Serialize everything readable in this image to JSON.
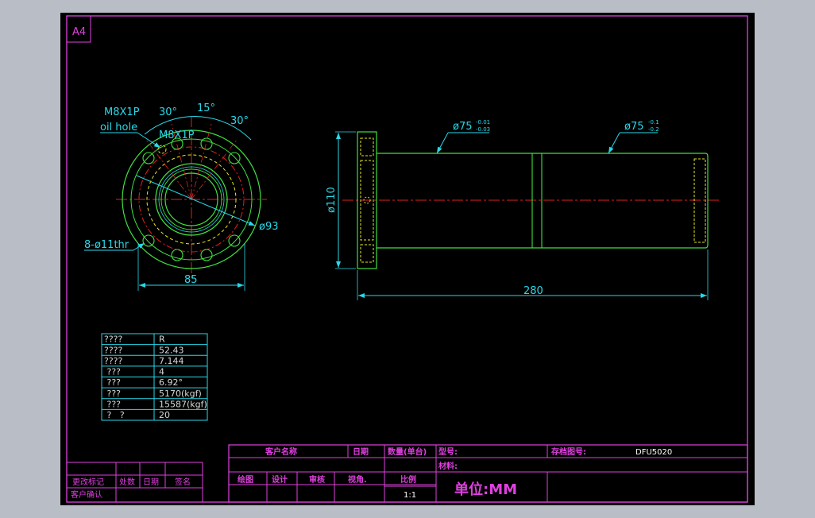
{
  "sheet": {
    "size_label": "A4"
  },
  "drawing": {
    "front_view": {
      "thread_label": "M8X1P",
      "oil_hole_label": "oil hole",
      "angle_left": "30°",
      "angle_mid": "15°",
      "angle_right": "30°",
      "pcd_label": "ø93",
      "holes_label": "8-ø11thr",
      "width_label": "85"
    },
    "side_view": {
      "dia_flange_label": "ø110",
      "dia_body1": "ø75",
      "tol1_upper": "-0.01",
      "tol1_lower": "-0.03",
      "dia_body2": "ø75",
      "tol2_upper": "-0.1",
      "tol2_lower": "-0.2",
      "length_label": "280"
    }
  },
  "spec_table": {
    "rows": [
      {
        "label": "????",
        "value": "R"
      },
      {
        "label": "????",
        "value": "52.43"
      },
      {
        "label": "????",
        "value": "7.144"
      },
      {
        "label": " ???",
        "value": "4"
      },
      {
        "label": " ???",
        "value": "6.92°"
      },
      {
        "label": " ???",
        "value": "5170(kgf)"
      },
      {
        "label": " ???",
        "value": "15587(kgf)"
      },
      {
        "label": " ?   ?",
        "value": "20"
      }
    ]
  },
  "revision_block": {
    "change_mark": "更改标记",
    "count": "处数",
    "date": "日期",
    "sign": "签名",
    "customer_confirm": "客户确认"
  },
  "title_block": {
    "customer_name": "客户名称",
    "date": "日期",
    "quantity": "数量(单台)",
    "model": "型号:",
    "archive_no": "存档图号:",
    "archive_value": "DFU5020",
    "material": "材料:",
    "drawn": "绘图",
    "design": "设计",
    "review": "审核",
    "view_angle": "视角.",
    "scale": "比例",
    "scale_value": "1:1",
    "unit": "单位:MM"
  },
  "colors": {
    "background": "#000000",
    "frame": "#e040e0",
    "outline": "#40e040",
    "dimension": "#28d8e8",
    "center_line": "#e02020",
    "hidden": "#e8e820",
    "page": "#b8bdc6"
  }
}
